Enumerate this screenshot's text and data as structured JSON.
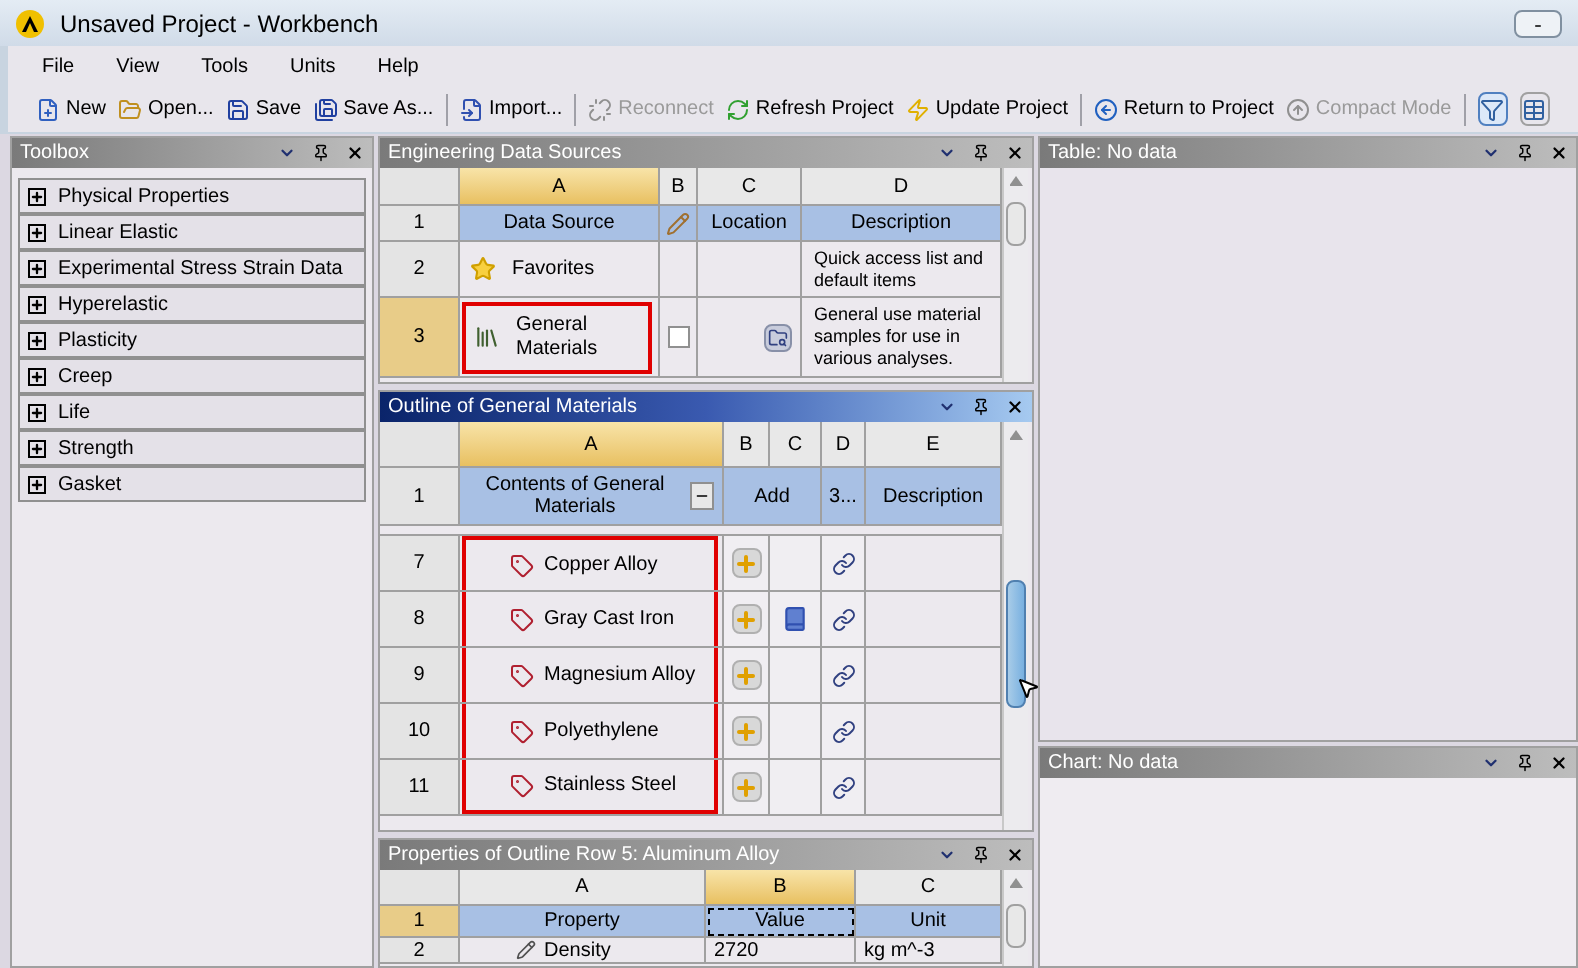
{
  "window": {
    "title": "Unsaved Project - Workbench"
  },
  "menu": [
    "File",
    "View",
    "Tools",
    "Units",
    "Help"
  ],
  "toolbar": [
    {
      "kind": "button",
      "label": "New",
      "disabled": false
    },
    {
      "kind": "button",
      "label": "Open...",
      "disabled": false
    },
    {
      "kind": "button",
      "label": "Save",
      "disabled": false
    },
    {
      "kind": "button",
      "label": "Save As...",
      "disabled": false
    },
    {
      "kind": "separator"
    },
    {
      "kind": "button",
      "label": "Import...",
      "disabled": false
    },
    {
      "kind": "separator"
    },
    {
      "kind": "button",
      "label": "Reconnect",
      "disabled": true
    },
    {
      "kind": "button",
      "label": "Refresh Project",
      "disabled": false
    },
    {
      "kind": "button",
      "label": "Update Project",
      "disabled": false
    },
    {
      "kind": "separator"
    },
    {
      "kind": "button",
      "label": "Return to Project",
      "disabled": false
    },
    {
      "kind": "button",
      "label": "Compact Mode",
      "disabled": true
    },
    {
      "kind": "separator"
    },
    {
      "kind": "toggle",
      "selected": true
    },
    {
      "kind": "toggle",
      "selected": false
    }
  ],
  "toolbox": {
    "title": "Toolbox",
    "items": [
      {
        "label": "Physical Properties",
        "expanded": false
      },
      {
        "label": "Linear Elastic",
        "expanded": false
      },
      {
        "label": "Experimental Stress Strain Data",
        "expanded": false
      },
      {
        "label": "Hyperelastic",
        "expanded": false
      },
      {
        "label": "Plasticity",
        "expanded": false
      },
      {
        "label": "Creep",
        "expanded": false
      },
      {
        "label": "Life",
        "expanded": false
      },
      {
        "label": "Strength",
        "expanded": false
      },
      {
        "label": "Gasket",
        "expanded": false
      }
    ]
  },
  "data_sources": {
    "title": "Engineering Data Sources",
    "active": false,
    "columns": [
      {
        "letter": "A",
        "selected": true
      },
      {
        "letter": "B",
        "selected": false
      },
      {
        "letter": "C",
        "selected": false
      },
      {
        "letter": "D",
        "selected": false
      }
    ],
    "header": {
      "number": "1",
      "source": "Data Source",
      "location": "Location",
      "description": "Description"
    },
    "rows": [
      {
        "kind": "favorites",
        "number": "2",
        "selected": false,
        "name": "Favorites",
        "highlighted": false,
        "description": "Quick access list and default items"
      },
      {
        "kind": "library",
        "number": "3",
        "selected": true,
        "name": "General Materials",
        "highlighted": true,
        "checked": false,
        "description": "General use material samples for use in various analyses."
      }
    ]
  },
  "outline": {
    "title": "Outline of General Materials",
    "active": true,
    "columns": [
      {
        "letter": "A",
        "selected": true
      },
      {
        "letter": "B",
        "selected": false
      },
      {
        "letter": "C",
        "selected": false
      },
      {
        "letter": "D",
        "selected": false
      },
      {
        "letter": "E",
        "selected": false
      }
    ],
    "header": {
      "number": "1",
      "contents": "Contents of General Materials",
      "add": "Add",
      "source": "3...",
      "description": "Description"
    },
    "rows": [
      {
        "number": "7",
        "name": "Copper Alloy",
        "in_favorites": false,
        "highlighted": true
      },
      {
        "number": "8",
        "name": "Gray Cast Iron",
        "in_favorites": true,
        "highlighted": true
      },
      {
        "number": "9",
        "name": "Magnesium Alloy",
        "in_favorites": false,
        "highlighted": true
      },
      {
        "number": "10",
        "name": "Polyethylene",
        "in_favorites": false,
        "highlighted": true
      },
      {
        "number": "11",
        "name": "Stainless Steel",
        "in_favorites": false,
        "highlighted": true
      }
    ]
  },
  "properties": {
    "title": "Properties of Outline Row 5: Aluminum Alloy",
    "active": false,
    "columns": [
      {
        "letter": "A",
        "selected": false
      },
      {
        "letter": "B",
        "selected": true
      },
      {
        "letter": "C",
        "selected": false
      }
    ],
    "header": {
      "number": "1",
      "property": "Property",
      "value": "Value",
      "unit": "Unit"
    },
    "rows": [
      {
        "number": "2",
        "property": "Density",
        "value": "2720",
        "unit": "kg m^-3"
      }
    ]
  },
  "table_panel": {
    "title": "Table: No data",
    "active": false
  },
  "chart_panel": {
    "title": "Chart: No data",
    "active": false
  }
}
